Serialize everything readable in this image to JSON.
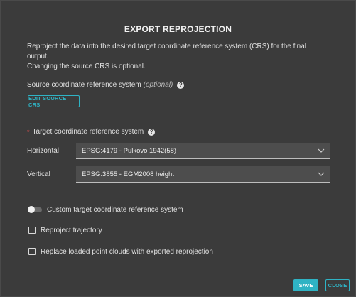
{
  "dialog": {
    "title": "EXPORT REPROJECTION",
    "description_line1": "Reproject the data into the desired target coordinate reference system (CRS) for the final output.",
    "description_line2": "Changing the source CRS is optional."
  },
  "source": {
    "label": "Source coordinate reference system",
    "optional": "(optional)",
    "help_glyph": "?",
    "edit_button": "EDIT SOURCE CRS"
  },
  "target": {
    "required_mark": "*",
    "label": "Target coordinate reference system",
    "help_glyph": "?",
    "horizontal_label": "Horizontal",
    "horizontal_value": "EPSG:4179 - Pulkovo 1942(58)",
    "vertical_label": "Vertical",
    "vertical_value": "EPSG:3855 - EGM2008 height"
  },
  "options": {
    "custom_target_label": "Custom target coordinate reference system",
    "custom_target_enabled": false,
    "reproject_trajectory_label": "Reproject trajectory",
    "reproject_trajectory_checked": false,
    "replace_point_clouds_label": "Replace loaded point clouds with exported reprojection",
    "replace_point_clouds_checked": false
  },
  "actions": {
    "save_label": "SAVE",
    "close_label": "CLOSE"
  },
  "colors": {
    "accent": "#2fb3c4",
    "background": "#3b3b3b",
    "required": "#e05050"
  }
}
